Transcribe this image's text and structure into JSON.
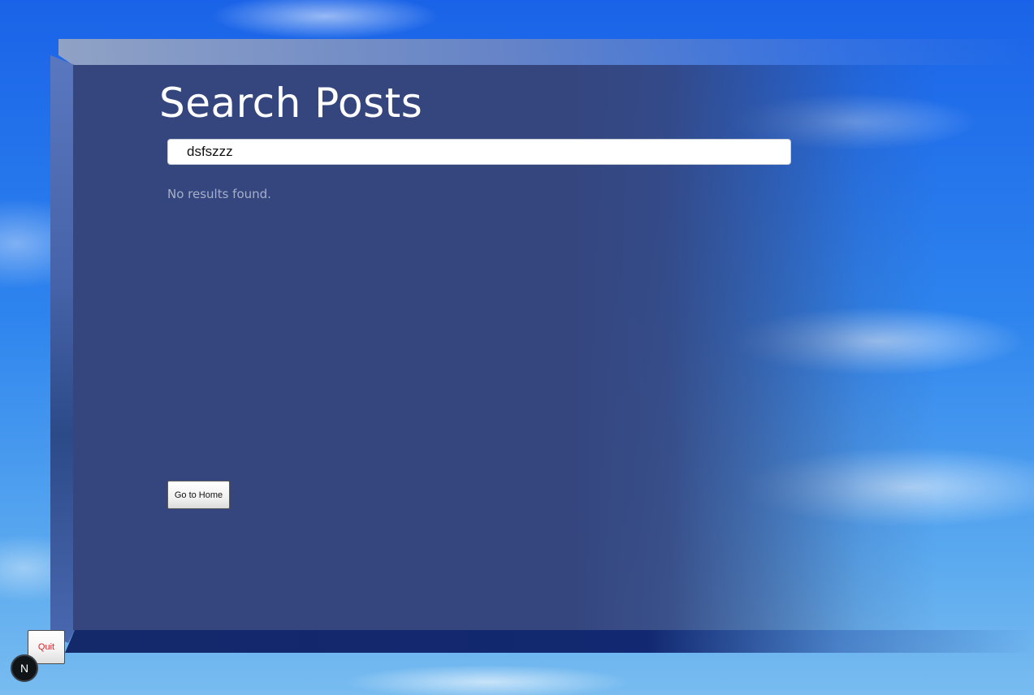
{
  "page": {
    "title": "Search Posts"
  },
  "search": {
    "value": "dsfszzz"
  },
  "results": {
    "empty_message": "No results found."
  },
  "actions": {
    "home_label": "Go to Home",
    "quit_label": "Quit"
  },
  "badge": {
    "letter": "N"
  },
  "colors": {
    "panel": "#35467f",
    "panel_shadow": "#14296a",
    "sky": "#2e84ee",
    "title_text": "#ffffff",
    "muted_text": "#a6afc8",
    "quit_text": "#d9232a",
    "badge_bg": "#111417"
  }
}
